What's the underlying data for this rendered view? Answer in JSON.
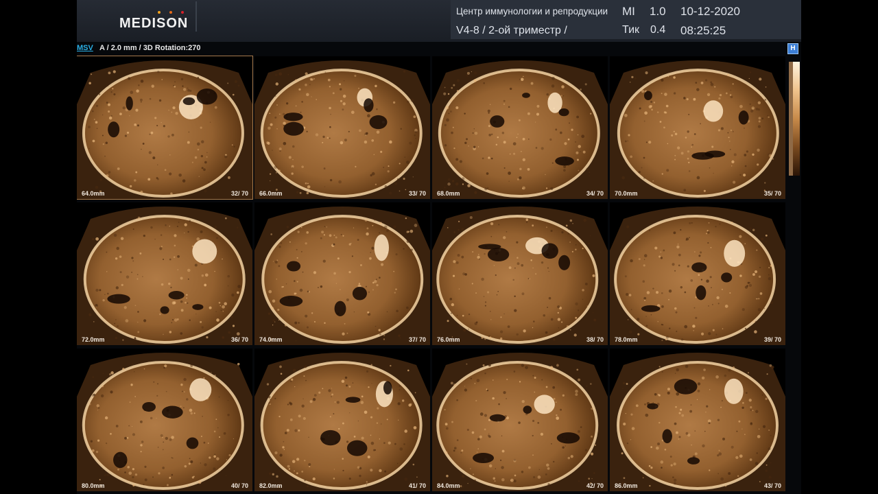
{
  "header": {
    "brand": "MEDISON",
    "brand_dots": [
      "#f2a21c",
      "#e56a1a",
      "#d8202a"
    ],
    "institution": "Центр иммунологии и репродукции",
    "probe_preset": "V4-8 / 2-ой триместр /",
    "mi_label": "MI",
    "mi_value": "1.0",
    "tib_label": "Тик",
    "tib_value": "0.4",
    "date": "10-12-2020",
    "time": "08:25:25"
  },
  "subbar": {
    "mode": "MSV",
    "settings": "A / 2.0 mm / 3D Rotation:270",
    "h_button": "H"
  },
  "colors": {
    "accent": "#2ab0e6",
    "tissue_dark": "#2a1406",
    "tissue_light": "#f0c38c"
  },
  "slices": [
    {
      "depth": "64.0mm",
      "frame": "32/ 70"
    },
    {
      "depth": "66.0mm",
      "frame": "33/ 70"
    },
    {
      "depth": "68.0mm",
      "frame": "34/ 70"
    },
    {
      "depth": "70.0mm",
      "frame": "35/ 70"
    },
    {
      "depth": "72.0mm",
      "frame": "36/ 70"
    },
    {
      "depth": "74.0mm",
      "frame": "37/ 70"
    },
    {
      "depth": "76.0mm",
      "frame": "38/ 70"
    },
    {
      "depth": "78.0mm",
      "frame": "39/ 70"
    },
    {
      "depth": "80.0mm",
      "frame": "40/ 70"
    },
    {
      "depth": "82.0mm",
      "frame": "41/ 70"
    },
    {
      "depth": "84.0mm",
      "frame": "42/ 70"
    },
    {
      "depth": "86.0mm",
      "frame": "43/ 70"
    }
  ]
}
